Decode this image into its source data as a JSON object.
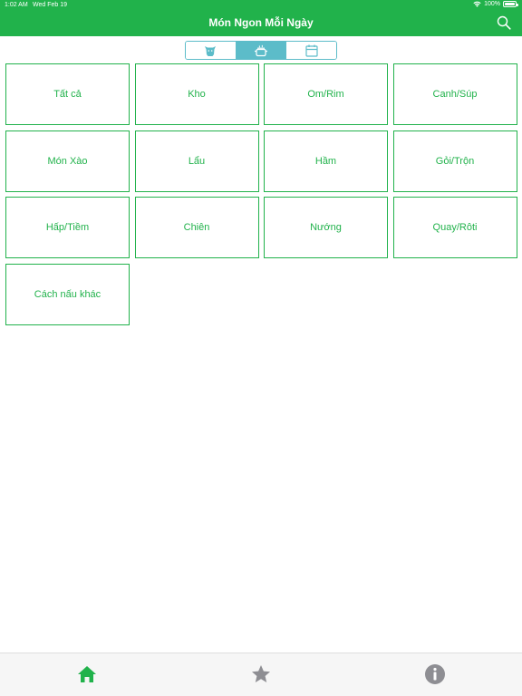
{
  "status_bar": {
    "time": "1:02 AM",
    "date": "Wed Feb 19",
    "battery": "100%",
    "icons": [
      "wifi-icon",
      "battery-icon"
    ]
  },
  "header": {
    "title": "Món Ngon Mỗi Ngày",
    "search_icon": "search-icon",
    "background_color": "#21b24b"
  },
  "segments": {
    "items": [
      {
        "icon": "cow-icon",
        "active": false
      },
      {
        "icon": "cooking-pot-icon",
        "active": true
      },
      {
        "icon": "calendar-icon",
        "active": false
      }
    ],
    "accent_color": "#5cbcc9"
  },
  "categories": [
    {
      "label": "Tất cả"
    },
    {
      "label": "Kho"
    },
    {
      "label": "Om/Rim"
    },
    {
      "label": "Canh/Súp"
    },
    {
      "label": "Món Xào"
    },
    {
      "label": "Lẩu"
    },
    {
      "label": "Hầm"
    },
    {
      "label": "Gỏi/Trộn"
    },
    {
      "label": "Hấp/Tiềm"
    },
    {
      "label": "Chiên"
    },
    {
      "label": "Nướng"
    },
    {
      "label": "Quay/Rôti"
    },
    {
      "label": "Cách nấu khác"
    }
  ],
  "tabbar": {
    "items": [
      {
        "icon": "home-icon",
        "active": true
      },
      {
        "icon": "star-icon",
        "active": false
      },
      {
        "icon": "info-icon",
        "active": false
      }
    ],
    "active_color": "#21b24b",
    "inactive_color": "#8e8e93"
  }
}
